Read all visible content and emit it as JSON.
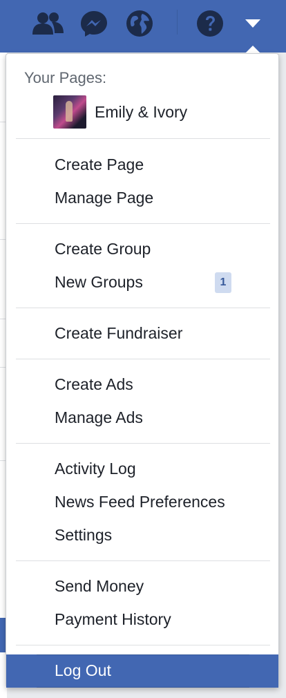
{
  "topbar": {
    "icons": [
      "friends-icon",
      "messenger-icon",
      "globe-icon",
      "help-icon",
      "dropdown-arrow-icon"
    ]
  },
  "menu": {
    "your_pages_label": "Your Pages:",
    "page": {
      "name": "Emily & Ivory"
    },
    "items": {
      "create_page": "Create Page",
      "manage_page": "Manage Page",
      "create_group": "Create Group",
      "new_groups": "New Groups",
      "new_groups_badge": "1",
      "create_fundraiser": "Create Fundraiser",
      "create_ads": "Create Ads",
      "manage_ads": "Manage Ads",
      "activity_log": "Activity Log",
      "news_feed_preferences": "News Feed Preferences",
      "settings": "Settings",
      "send_money": "Send Money",
      "payment_history": "Payment History",
      "log_out": "Log Out"
    }
  },
  "colors": {
    "brand_blue": "#4267b2",
    "badge_bg": "#cfdbf0",
    "badge_text": "#365899"
  }
}
